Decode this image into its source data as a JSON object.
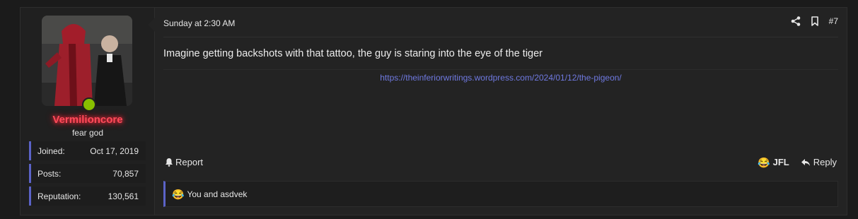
{
  "post": {
    "user": {
      "username": "Vermilioncore",
      "title": "fear god",
      "avatar_icon": "user-avatar-photo",
      "online": true,
      "username_color": "#ff4b5a",
      "stats": [
        {
          "label": "Joined:",
          "value": "Oct 17, 2019"
        },
        {
          "label": "Posts:",
          "value": "70,857"
        },
        {
          "label": "Reputation:",
          "value": "130,561"
        }
      ]
    },
    "date": "Sunday at 2:30 AM",
    "post_number": "#7",
    "message": "Imagine getting backshots with that tattoo, the guy is staring into the eye of the tiger",
    "signature_link": "https://theinferiorwritings.wordpress.com/2024/01/12/the-pigeon/",
    "actions": {
      "share_icon": "share-icon",
      "bookmark_icon": "bookmark-icon",
      "report_label": "Report",
      "report_icon": "bell-icon",
      "reaction_label": "JFL",
      "reaction_icon": "laughing-emoji",
      "reply_label": "Reply",
      "reply_icon": "reply-arrow-icon"
    },
    "reactions_summary": "You and asdvek",
    "accent_color": "#5b63c7",
    "link_color": "#6f79e0"
  }
}
